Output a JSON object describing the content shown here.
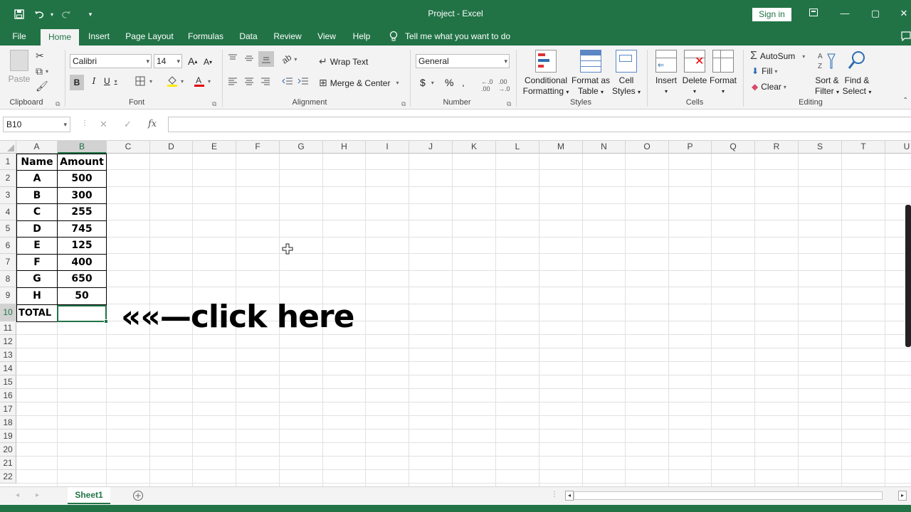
{
  "window": {
    "title": "Project  -  Excel",
    "sign_in": "Sign in"
  },
  "qat": {
    "save_icon": "save-icon",
    "undo_icon": "undo-icon",
    "redo_icon": "redo-icon",
    "customize_icon": "customize-icon"
  },
  "menu": {
    "tabs": [
      "File",
      "Home",
      "Insert",
      "Page Layout",
      "Formulas",
      "Data",
      "Review",
      "View",
      "Help"
    ],
    "active": "Home",
    "tell_me": "Tell me what you want to do"
  },
  "ribbon": {
    "clipboard": {
      "paste": "Paste",
      "label": "Clipboard"
    },
    "font": {
      "name": "Calibri",
      "size": "14",
      "bold": "B",
      "italic": "I",
      "underline": "U",
      "grow": "A",
      "shrink": "A",
      "label": "Font"
    },
    "alignment": {
      "wrap": "Wrap Text",
      "merge": "Merge & Center",
      "label": "Alignment"
    },
    "number": {
      "format": "General",
      "currency": "$",
      "percent": "%",
      "comma": "̹",
      "label": "Number"
    },
    "styles": {
      "conditional_1": "Conditional",
      "conditional_2": "Formatting",
      "format_table_1": "Format as",
      "format_table_2": "Table",
      "cell_styles_1": "Cell",
      "cell_styles_2": "Styles",
      "label": "Styles"
    },
    "cells": {
      "insert": "Insert",
      "delete": "Delete",
      "format": "Format",
      "label": "Cells"
    },
    "editing": {
      "autosum": "AutoSum",
      "fill": "Fill",
      "clear": "Clear",
      "sort_1": "Sort &",
      "sort_2": "Filter",
      "find_1": "Find &",
      "find_2": "Select",
      "label": "Editing"
    }
  },
  "formula_bar": {
    "name_box": "B10",
    "cancel": "✕",
    "enter": "✓",
    "fx": "fx",
    "value": ""
  },
  "grid": {
    "columns": [
      "A",
      "B",
      "C",
      "D",
      "E",
      "F",
      "G",
      "H",
      "I",
      "J",
      "K",
      "L",
      "M",
      "N",
      "O",
      "P",
      "Q",
      "R",
      "S",
      "T",
      "U"
    ],
    "rows": [
      "1",
      "2",
      "3",
      "4",
      "5",
      "6",
      "7",
      "8",
      "9",
      "10",
      "11",
      "12",
      "13",
      "14",
      "15",
      "16",
      "17",
      "18",
      "19",
      "20",
      "21",
      "22"
    ],
    "selected_col": "B",
    "selected_row": "10"
  },
  "table": {
    "header": [
      "Name",
      "Amount"
    ],
    "rows": [
      [
        "A",
        "500"
      ],
      [
        "B",
        "300"
      ],
      [
        "C",
        "255"
      ],
      [
        "D",
        "745"
      ],
      [
        "E",
        "125"
      ],
      [
        "F",
        "400"
      ],
      [
        "G",
        "650"
      ],
      [
        "H",
        "50"
      ]
    ],
    "total_label": "TOTAL",
    "total_value": ""
  },
  "annotation": "««—click here",
  "sheets": {
    "active": "Sheet1",
    "add_icon": "plus-icon"
  }
}
